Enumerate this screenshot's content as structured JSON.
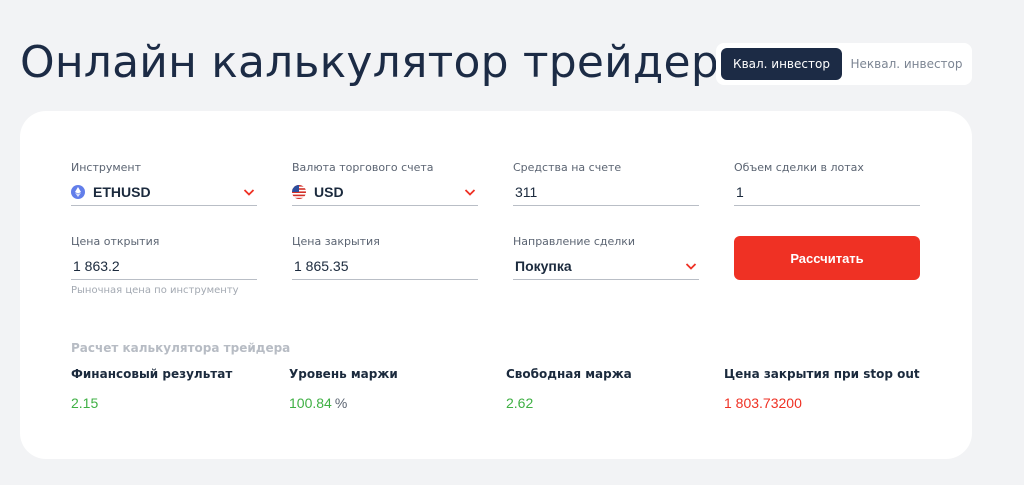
{
  "header": {
    "title": "Онлайн калькулятор трейдера",
    "toggle": {
      "active_label": "Квал. инвестор",
      "inactive_label": "Неквал. инвестор"
    }
  },
  "form": {
    "instrument": {
      "label": "Инструмент",
      "value": "ETHUSD",
      "icon": "ethereum-icon"
    },
    "currency": {
      "label": "Валюта торгового счета",
      "value": "USD",
      "icon": "us-flag-icon"
    },
    "funds": {
      "label": "Средства на счете",
      "value": "311"
    },
    "lots": {
      "label": "Объем сделки в лотах",
      "value": "1"
    },
    "open_price": {
      "label": "Цена открытия",
      "value": "1 863.2",
      "hint": "Рыночная цена по инструменту"
    },
    "close_price": {
      "label": "Цена закрытия",
      "value": "1 865.35"
    },
    "direction": {
      "label": "Направление сделки",
      "value": "Покупка"
    },
    "calculate_label": "Рассчитать"
  },
  "results": {
    "section_title": "Расчет калькулятора трейдера",
    "financial_result": {
      "label": "Финансовый результат",
      "value": "2.15"
    },
    "margin_level": {
      "label": "Уровень маржи",
      "value": "100.84",
      "unit": "%"
    },
    "free_margin": {
      "label": "Свободная маржа",
      "value": "2.62"
    },
    "stop_out_price": {
      "label": "Цена закрытия при stop out",
      "value": "1 803.73200"
    }
  },
  "colors": {
    "accent": "#ef3124",
    "dark": "#1c2b45",
    "positive": "#3fb044",
    "negative": "#ef3124"
  }
}
